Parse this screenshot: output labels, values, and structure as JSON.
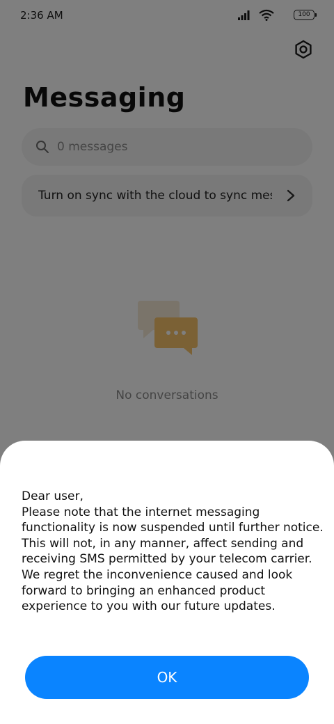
{
  "status_bar": {
    "time": "2:36 AM",
    "battery": "100"
  },
  "page": {
    "title": "Messaging"
  },
  "search": {
    "placeholder": "0 messages"
  },
  "sync_banner": {
    "text": "Turn on sync with the cloud to sync messages"
  },
  "empty_state": {
    "text": "No conversations"
  },
  "dialog": {
    "message": "Dear user,\nPlease note that the internet messaging functionality is now suspended until further notice. This will not, in any manner, affect sending and receiving SMS permitted by your telecom carrier. We regret the inconvenience caused and look forward to bringing an enhanced product experience to you with our future updates.",
    "ok_label": "OK"
  },
  "colors": {
    "accent": "#0a84ff",
    "empty_icon": "#f6c36b"
  }
}
